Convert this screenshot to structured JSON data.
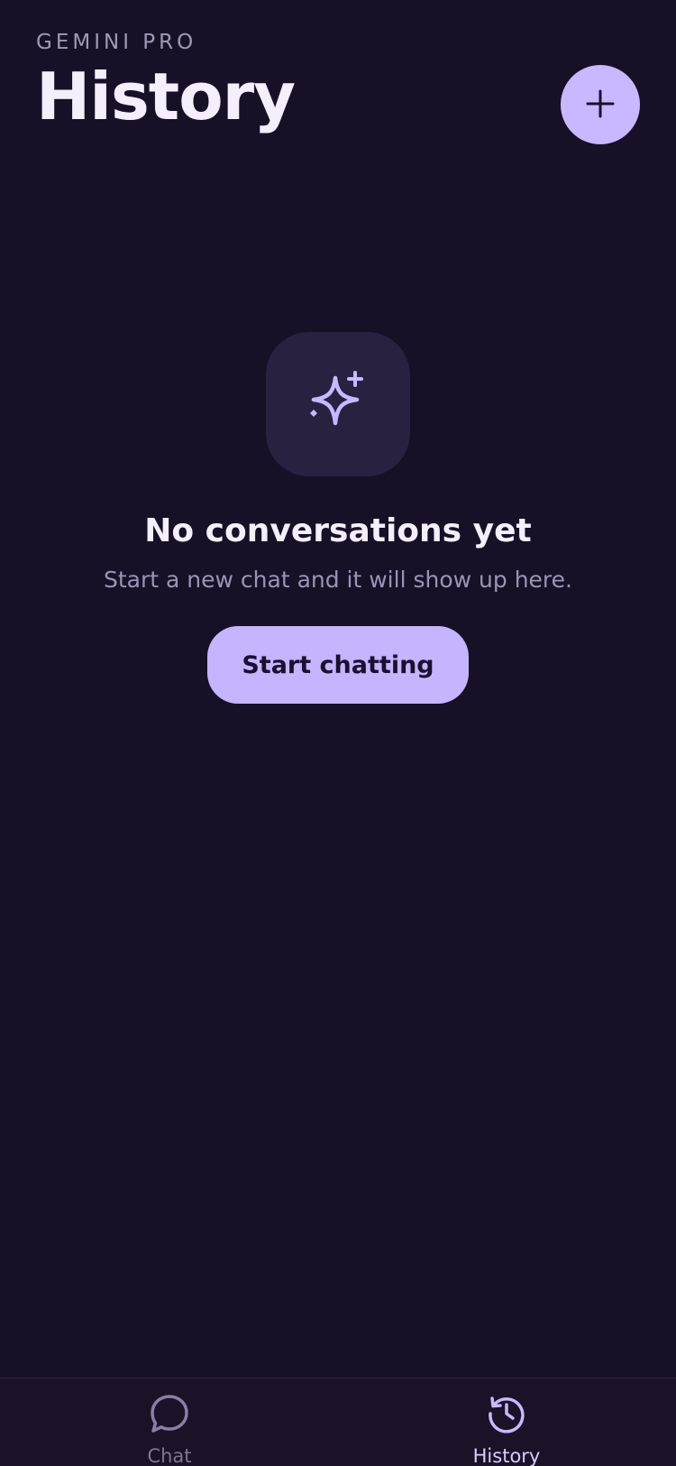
{
  "header": {
    "app_name": "GEMINI PRO",
    "title": "History",
    "new_chat_icon": "plus-icon"
  },
  "empty_state": {
    "icon": "sparkles-icon",
    "title": "No conversations yet",
    "subtitle": "Start a new chat and it will show up here.",
    "button_label": "Start chatting"
  },
  "bottom_nav": {
    "items": [
      {
        "label": "Chat",
        "icon": "chat-bubble-icon",
        "active": false
      },
      {
        "label": "History",
        "icon": "history-clock-icon",
        "active": true
      }
    ]
  },
  "colors": {
    "background": "#181026",
    "accent": "#c9b8ff",
    "muted_text": "#9d92b6",
    "tile": "#2a2140"
  }
}
